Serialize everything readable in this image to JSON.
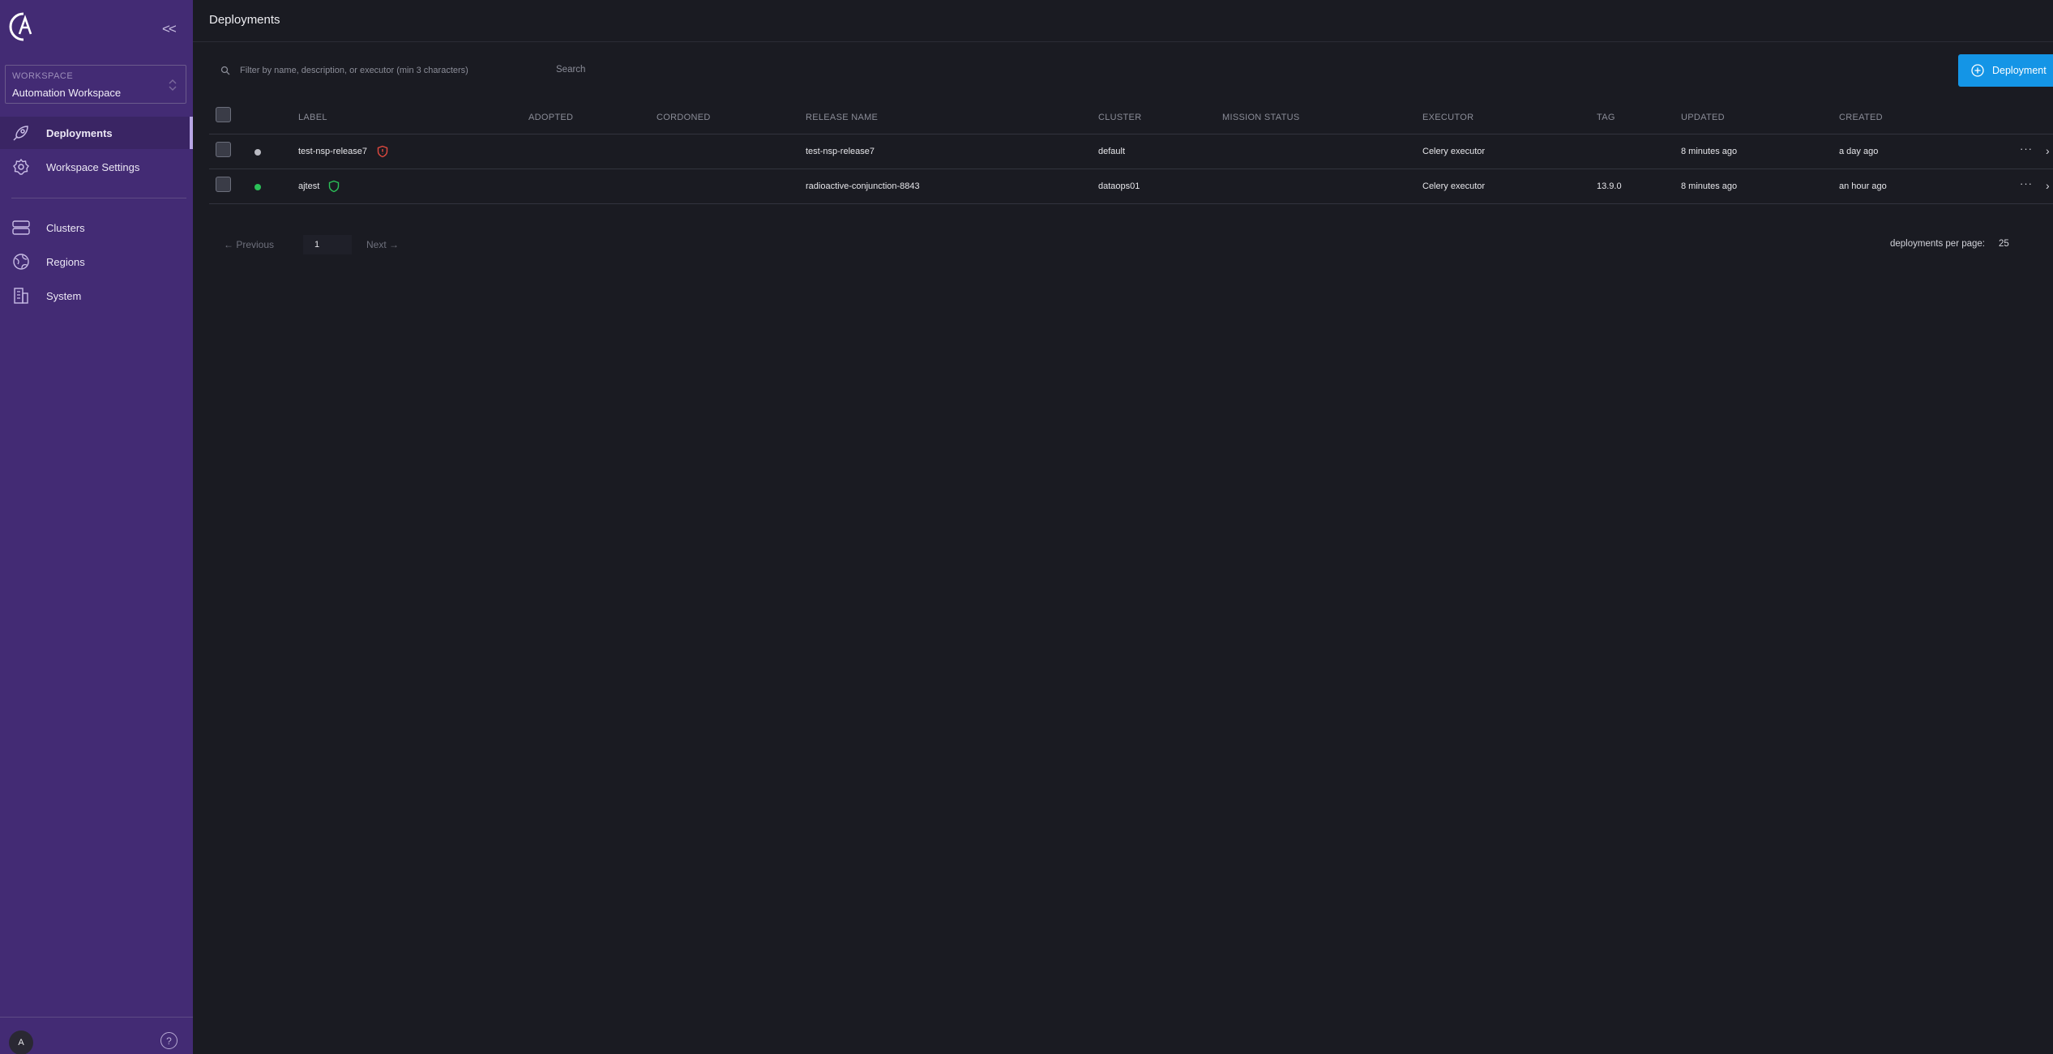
{
  "sidebar": {
    "workspace_label": "WORKSPACE",
    "workspace_value": "Automation Workspace",
    "collapse_label": "<<",
    "items": [
      {
        "label": "Deployments",
        "icon": "rocket-icon",
        "active": true
      },
      {
        "label": "Workspace Settings",
        "icon": "gear-icon",
        "active": false
      },
      {
        "label": "Clusters",
        "icon": "server-icon",
        "active": false
      },
      {
        "label": "Regions",
        "icon": "globe-icon",
        "active": false
      },
      {
        "label": "System",
        "icon": "building-icon",
        "active": false
      }
    ],
    "avatar_initial": "A",
    "help_label": "?"
  },
  "header": {
    "title": "Deployments"
  },
  "toolbar": {
    "search_placeholder": "Filter by name, description, or executor (min 3 characters)",
    "search_button": "Search",
    "add_button": "Deployment"
  },
  "table": {
    "columns": [
      "LABEL",
      "ADOPTED",
      "CORDONED",
      "RELEASE NAME",
      "CLUSTER",
      "MISSION STATUS",
      "EXECUTOR",
      "TAG",
      "UPDATED",
      "CREATED"
    ],
    "rows": [
      {
        "status_color": "#b9bac2",
        "label": "test-nsp-release7",
        "shield_color": "#e0493f",
        "adopted": "",
        "cordoned": "",
        "release_name": "test-nsp-release7",
        "cluster": "default",
        "mission_status": "",
        "executor": "Celery executor",
        "tag": "",
        "updated": "8 minutes ago",
        "created": "a day ago"
      },
      {
        "status_color": "#2bc158",
        "label": "ajtest",
        "shield_color": "#2bc158",
        "adopted": "",
        "cordoned": "",
        "release_name": "radioactive-conjunction-8843",
        "cluster": "dataops01",
        "mission_status": "",
        "executor": "Celery executor",
        "tag": "13.9.0",
        "updated": "8 minutes ago",
        "created": "an hour ago"
      }
    ],
    "more_label": "···",
    "arrow_label": "›"
  },
  "pagination": {
    "previous": "← Previous",
    "page": "1",
    "next": "Next →",
    "per_page_label": "deployments per page:",
    "per_page_value": "25"
  },
  "colors": {
    "sidebar_bg": "#432b74",
    "main_bg": "#1a1b22",
    "accent": "#1495e6"
  }
}
